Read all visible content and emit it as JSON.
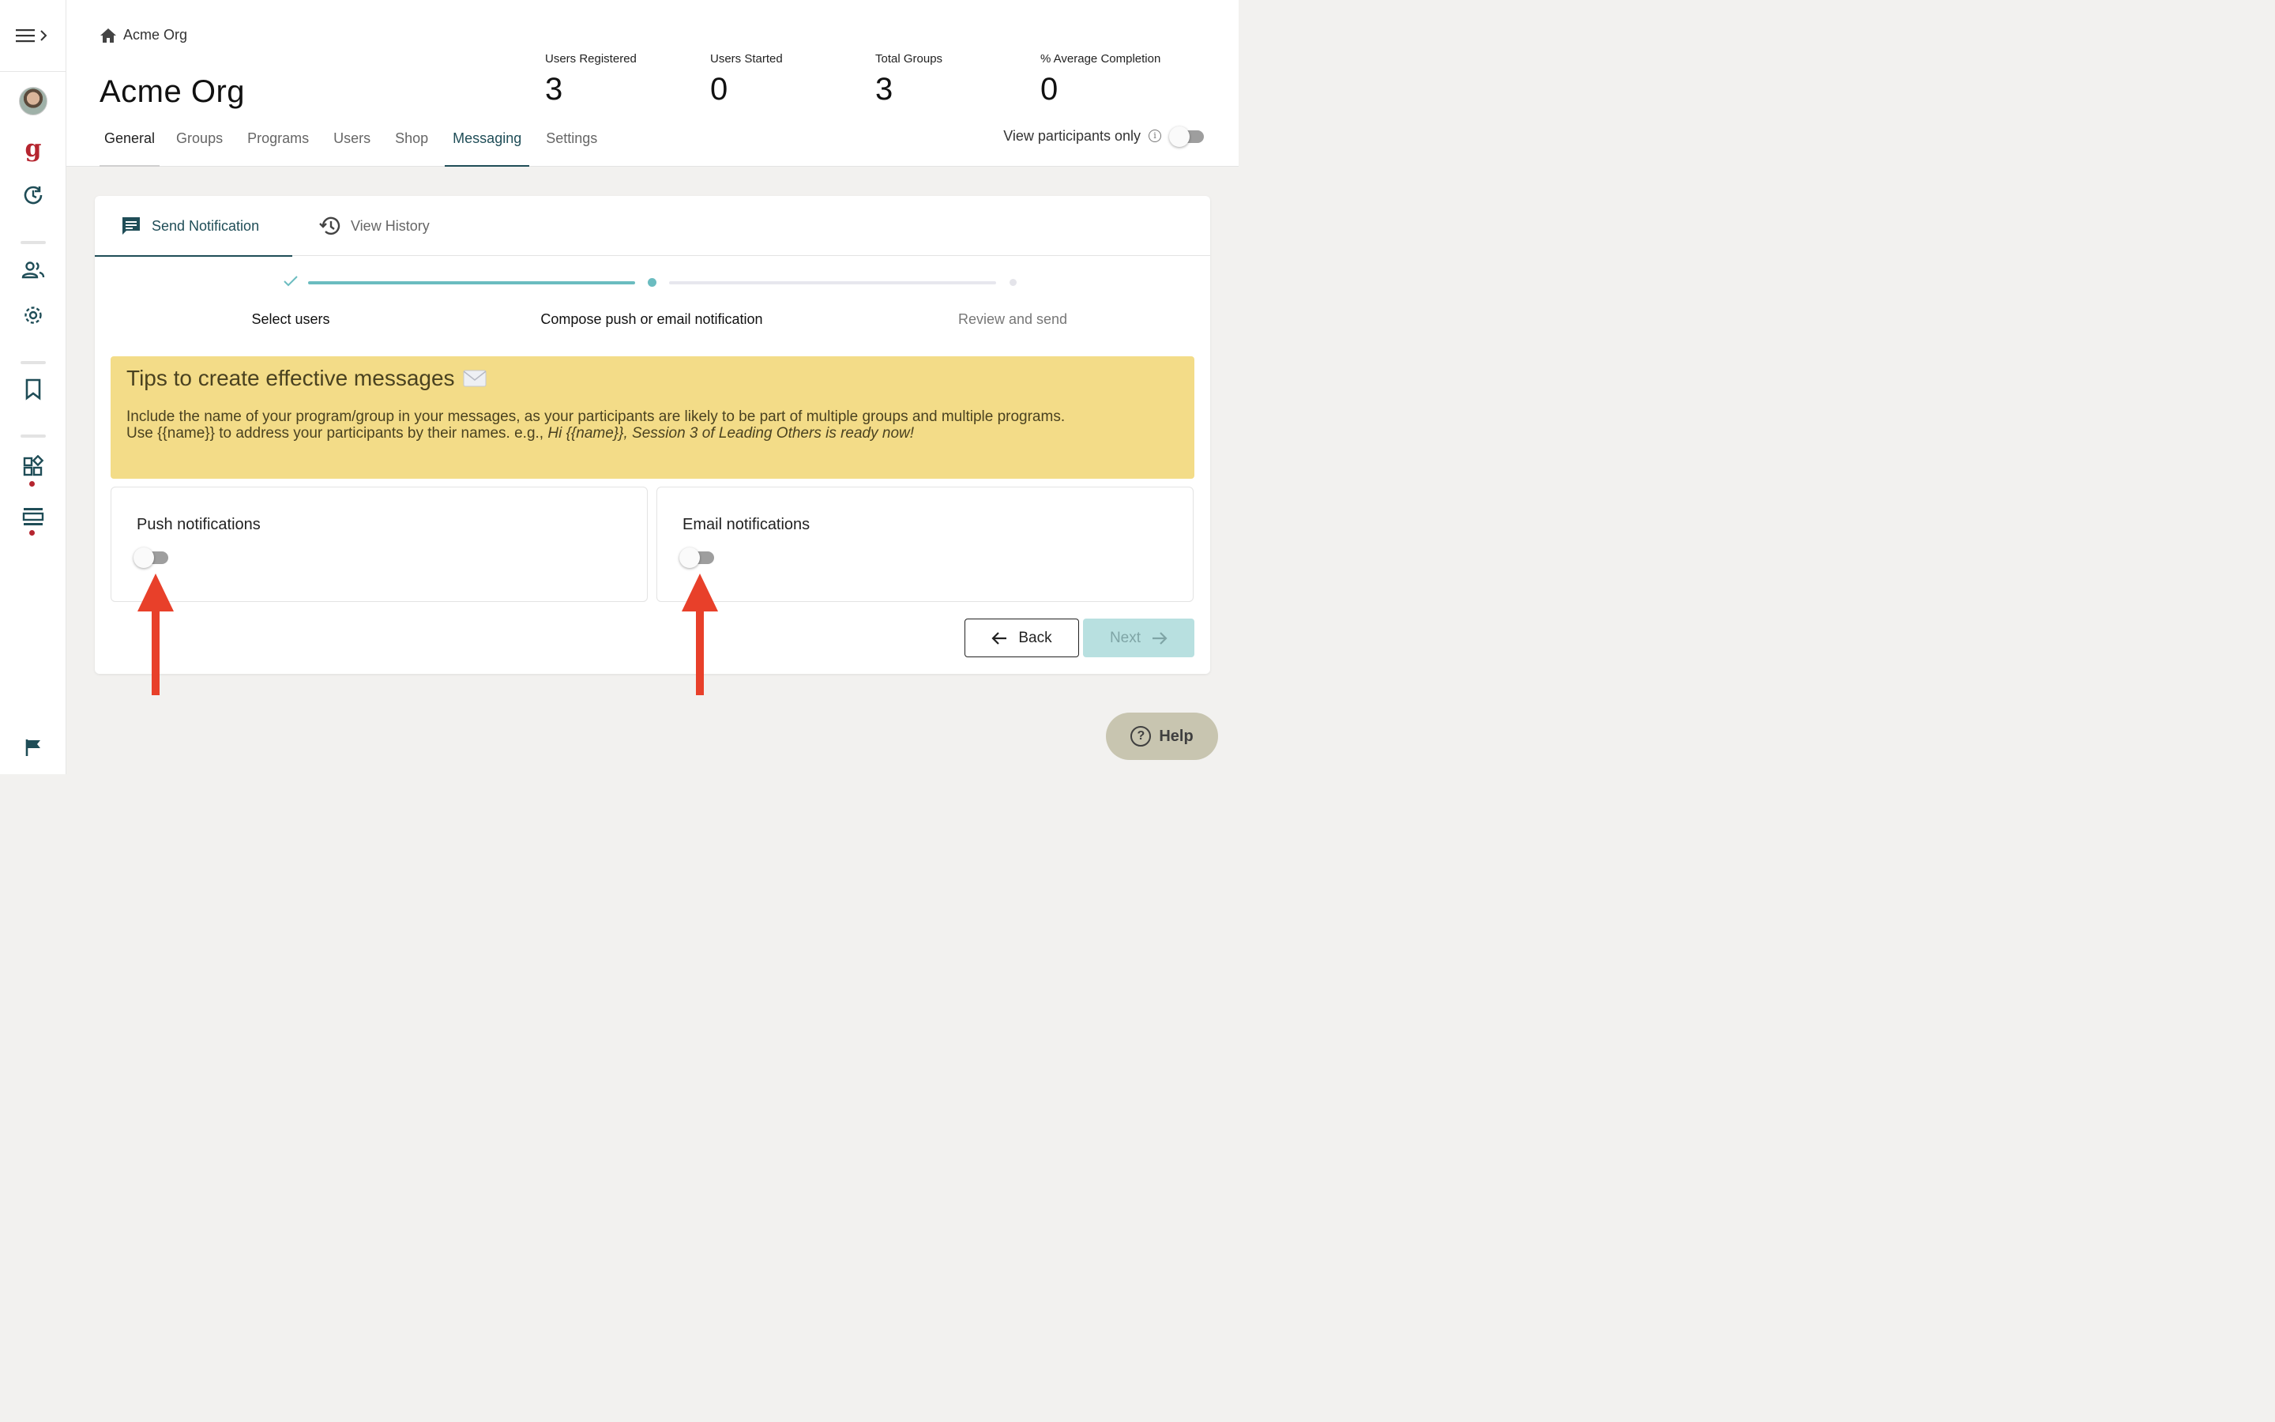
{
  "breadcrumb": {
    "label": "Acme Org"
  },
  "page": {
    "title": "Acme Org"
  },
  "stats": [
    {
      "label": "Users Registered",
      "value": "3"
    },
    {
      "label": "Users Started",
      "value": "0"
    },
    {
      "label": "Total Groups",
      "value": "3"
    },
    {
      "label": "% Average Completion",
      "value": "0"
    }
  ],
  "tabs": [
    "General",
    "Groups",
    "Programs",
    "Users",
    "Shop",
    "Messaging",
    "Settings"
  ],
  "active_tab": "Messaging",
  "view_participants": {
    "label": "View participants only",
    "enabled": false
  },
  "card_tabs": {
    "send": "Send Notification",
    "history": "View History"
  },
  "stepper": {
    "steps": [
      "Select users",
      "Compose push or email notification",
      "Review and send"
    ],
    "current_step": 2
  },
  "tips": {
    "title": "Tips to create effective messages",
    "line1": "Include the name of your program/group in your messages, as your participants are likely to be part of multiple groups and multiple programs.",
    "line2_prefix": "Use {{name}} to address your participants by their names. e.g., ",
    "line2_example": "Hi {{name}}, Session 3 of Leading Others is ready now!"
  },
  "push": {
    "label": "Push notifications",
    "enabled": false
  },
  "email": {
    "label": "Email notifications",
    "enabled": false
  },
  "buttons": {
    "back": "Back",
    "next": "Next"
  },
  "help": {
    "label": "Help"
  },
  "colors": {
    "teal": "#1f4d57",
    "progress": "#6bbcc0",
    "tips_bg": "#f3dc88",
    "brand_red": "#b5252f",
    "arrow": "#e8402a"
  }
}
